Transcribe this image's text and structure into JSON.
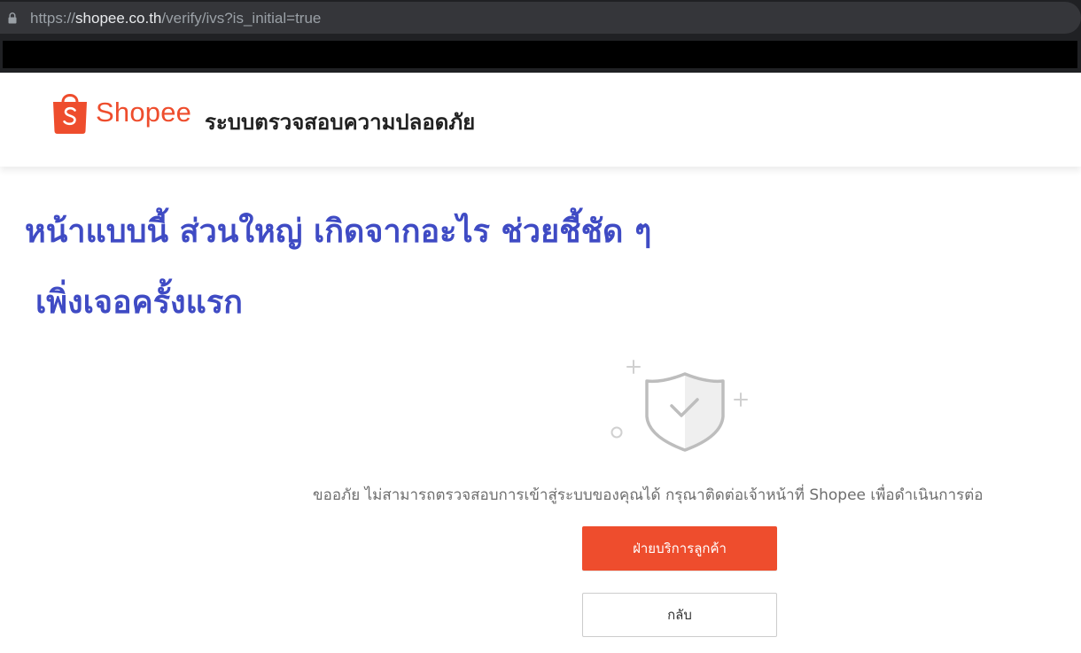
{
  "browser": {
    "url_prefix": "https://",
    "url_host": "shopee.co.th",
    "url_path": "/verify/ivs?is_initial=true",
    "icons": {
      "lock": "lock-icon"
    }
  },
  "header": {
    "brand_name": "Shopee",
    "title": "ระบบตรวจสอบความปลอดภัย",
    "brand_color": "#ee4d2d",
    "icons": {
      "logo": "shopping-bag-logo-icon"
    }
  },
  "annotation": {
    "line1": "หน้าแบบนี้ ส่วนใหญ่ เกิดจากอะไร ช่วยชี้ชัด ๆ",
    "line2": "เพิ่งเจอครั้งแรก",
    "color": "#3f4bc4"
  },
  "main": {
    "illustration_icon": "shield-check-icon",
    "message": "ขออภัย ไม่สามารถตรวจสอบการเข้าสู่ระบบของคุณได้ กรุณาติดต่อเจ้าหน้าที่ Shopee เพื่อดำเนินการต่อ",
    "primary_button": "ฝ่ายบริการลูกค้า",
    "secondary_button": "กลับ"
  }
}
